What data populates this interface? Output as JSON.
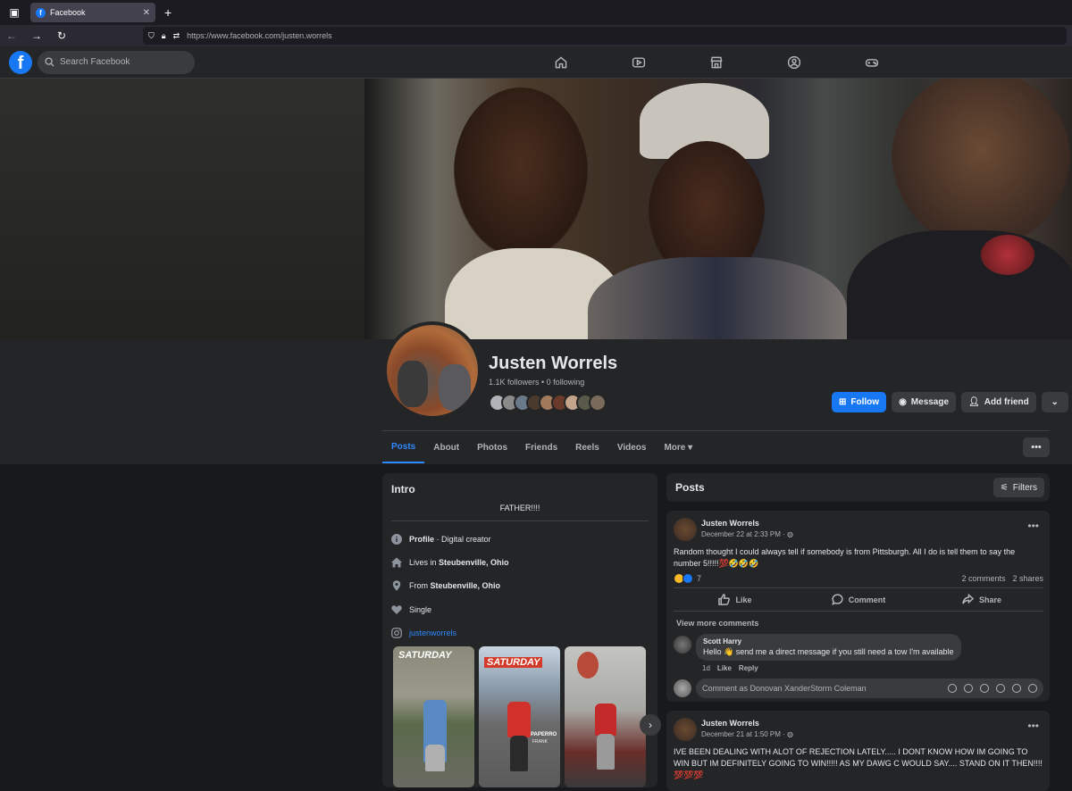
{
  "browser": {
    "tab_title": "Facebook",
    "url": "https://www.facebook.com/justen.worrels"
  },
  "header": {
    "search_placeholder": "Search Facebook"
  },
  "profile": {
    "name": "Justen Worrels",
    "followers": "1.1K followers • 0 following",
    "buttons": {
      "follow": "Follow",
      "message": "Message",
      "add_friend": "Add friend"
    }
  },
  "tabs": [
    "Posts",
    "About",
    "Photos",
    "Friends",
    "Reels",
    "Videos",
    "More ▾"
  ],
  "intro": {
    "title": "Intro",
    "bio": "FATHER!!!!",
    "profile_label": "Profile",
    "profile_value": " · Digital creator",
    "lives_prefix": "Lives in ",
    "lives_city": "Steubenville, Ohio",
    "from_prefix": "From ",
    "from_city": "Steubenville, Ohio",
    "relationship": "Single",
    "instagram": "justenworrels",
    "photo_captions": [
      "SATURDAY",
      "SATURDAY"
    ],
    "photo_sign": "PAPERRO",
    "photo_sign2": "FRANK"
  },
  "posts_section": {
    "title": "Posts",
    "filters": "Filters"
  },
  "posts": [
    {
      "author": "Justen Worrels",
      "date": "December 22 at 2:33 PM · ",
      "text": "Random thought I could always tell if somebody is from Pittsburgh. All I do is tell them to say the number 5!!!!!💯🤣🤣🤣",
      "reactions": "7",
      "comments": "2 comments",
      "shares": "2 shares",
      "actions": {
        "like": "Like",
        "comment": "Comment",
        "share": "Share"
      },
      "view_more": "View more comments",
      "comment": {
        "author": "Scott Harry",
        "text": "Hello 👋 send me a direct message if you still need a tow I'm available",
        "time": "1d",
        "like": "Like",
        "reply": "Reply"
      },
      "write_placeholder": "Comment as Donovan XanderStorm Coleman"
    },
    {
      "author": "Justen Worrels",
      "date": "December 21 at 1:50 PM · ",
      "text": "IVE BEEN DEALING WITH ALOT OF REJECTION LATELY..... I DONT KNOW HOW IM GOING TO WIN BUT IM DEFINITELY GOING TO WIN!!!!! AS MY DAWG C WOULD SAY.... STAND ON IT THEN!!!!💯💯💯"
    }
  ]
}
